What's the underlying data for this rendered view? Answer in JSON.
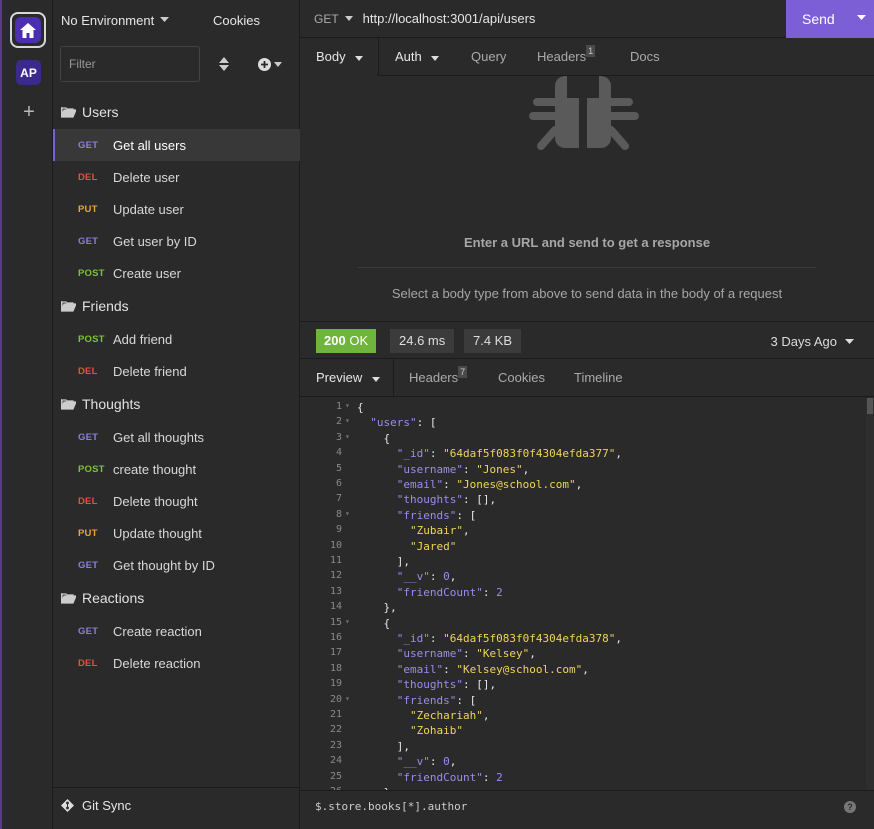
{
  "sidebar": {
    "environment": "No Environment",
    "cookies": "Cookies",
    "filter_placeholder": "Filter",
    "folders": [
      {
        "name": "Users",
        "requests": [
          {
            "method": "GET",
            "label": "Get all users",
            "active": true
          },
          {
            "method": "DEL",
            "label": "Delete user"
          },
          {
            "method": "PUT",
            "label": "Update user"
          },
          {
            "method": "GET",
            "label": "Get user by ID"
          },
          {
            "method": "POST",
            "label": "Create user"
          }
        ]
      },
      {
        "name": "Friends",
        "requests": [
          {
            "method": "POST",
            "label": "Add friend"
          },
          {
            "method": "DEL",
            "label": "Delete friend"
          }
        ]
      },
      {
        "name": "Thoughts",
        "requests": [
          {
            "method": "GET",
            "label": "Get all thoughts"
          },
          {
            "method": "POST",
            "label": "create thought"
          },
          {
            "method": "DEL",
            "label": "Delete thought"
          },
          {
            "method": "PUT",
            "label": "Update thought"
          },
          {
            "method": "GET",
            "label": "Get thought by ID"
          }
        ]
      },
      {
        "name": "Reactions",
        "requests": [
          {
            "method": "GET",
            "label": "Create reaction"
          },
          {
            "method": "DEL",
            "label": "Delete reaction"
          }
        ]
      }
    ],
    "git_sync": "Git Sync"
  },
  "rail": {
    "workspace_initials": "AP"
  },
  "request": {
    "method": "GET",
    "url": "http://localhost:3001/api/users",
    "send_label": "Send",
    "tabs": {
      "body": "Body",
      "auth": "Auth",
      "query": "Query",
      "headers": "Headers",
      "headers_count": "1",
      "docs": "Docs"
    },
    "empty_message": "Enter a URL and send to get a response",
    "body_hint": "Select a body type from above to send data in the body of a request"
  },
  "response": {
    "status_code": "200",
    "status_text": "OK",
    "time": "24.6 ms",
    "size": "7.4 KB",
    "ago": "3 Days Ago",
    "tabs": {
      "preview": "Preview",
      "headers": "Headers",
      "headers_count": "7",
      "cookies": "Cookies",
      "timeline": "Timeline"
    },
    "code_lines": [
      "{",
      "  \"users\": [",
      "    {",
      "      \"_id\": \"64daf5f083f0f4304efda377\",",
      "      \"username\": \"Jones\",",
      "      \"email\": \"Jones@school.com\",",
      "      \"thoughts\": [],",
      "      \"friends\": [",
      "        \"Zubair\",",
      "        \"Jared\"",
      "      ],",
      "      \"__v\": 0,",
      "      \"friendCount\": 2",
      "    },",
      "    {",
      "      \"_id\": \"64daf5f083f0f4304efda378\",",
      "      \"username\": \"Kelsey\",",
      "      \"email\": \"Kelsey@school.com\",",
      "      \"thoughts\": [],",
      "      \"friends\": [",
      "        \"Zechariah\",",
      "        \"Zohaib\"",
      "      ],",
      "      \"__v\": 0,",
      "      \"friendCount\": 2",
      "    },"
    ],
    "filter_query": "$.store.books[*].author"
  },
  "colors": {
    "accent": "#7c5fd6",
    "status_ok": "#6fb43d",
    "get": "#8a7fe0",
    "del": "#e0533f",
    "put": "#e8a33a",
    "post": "#7bc23a"
  }
}
